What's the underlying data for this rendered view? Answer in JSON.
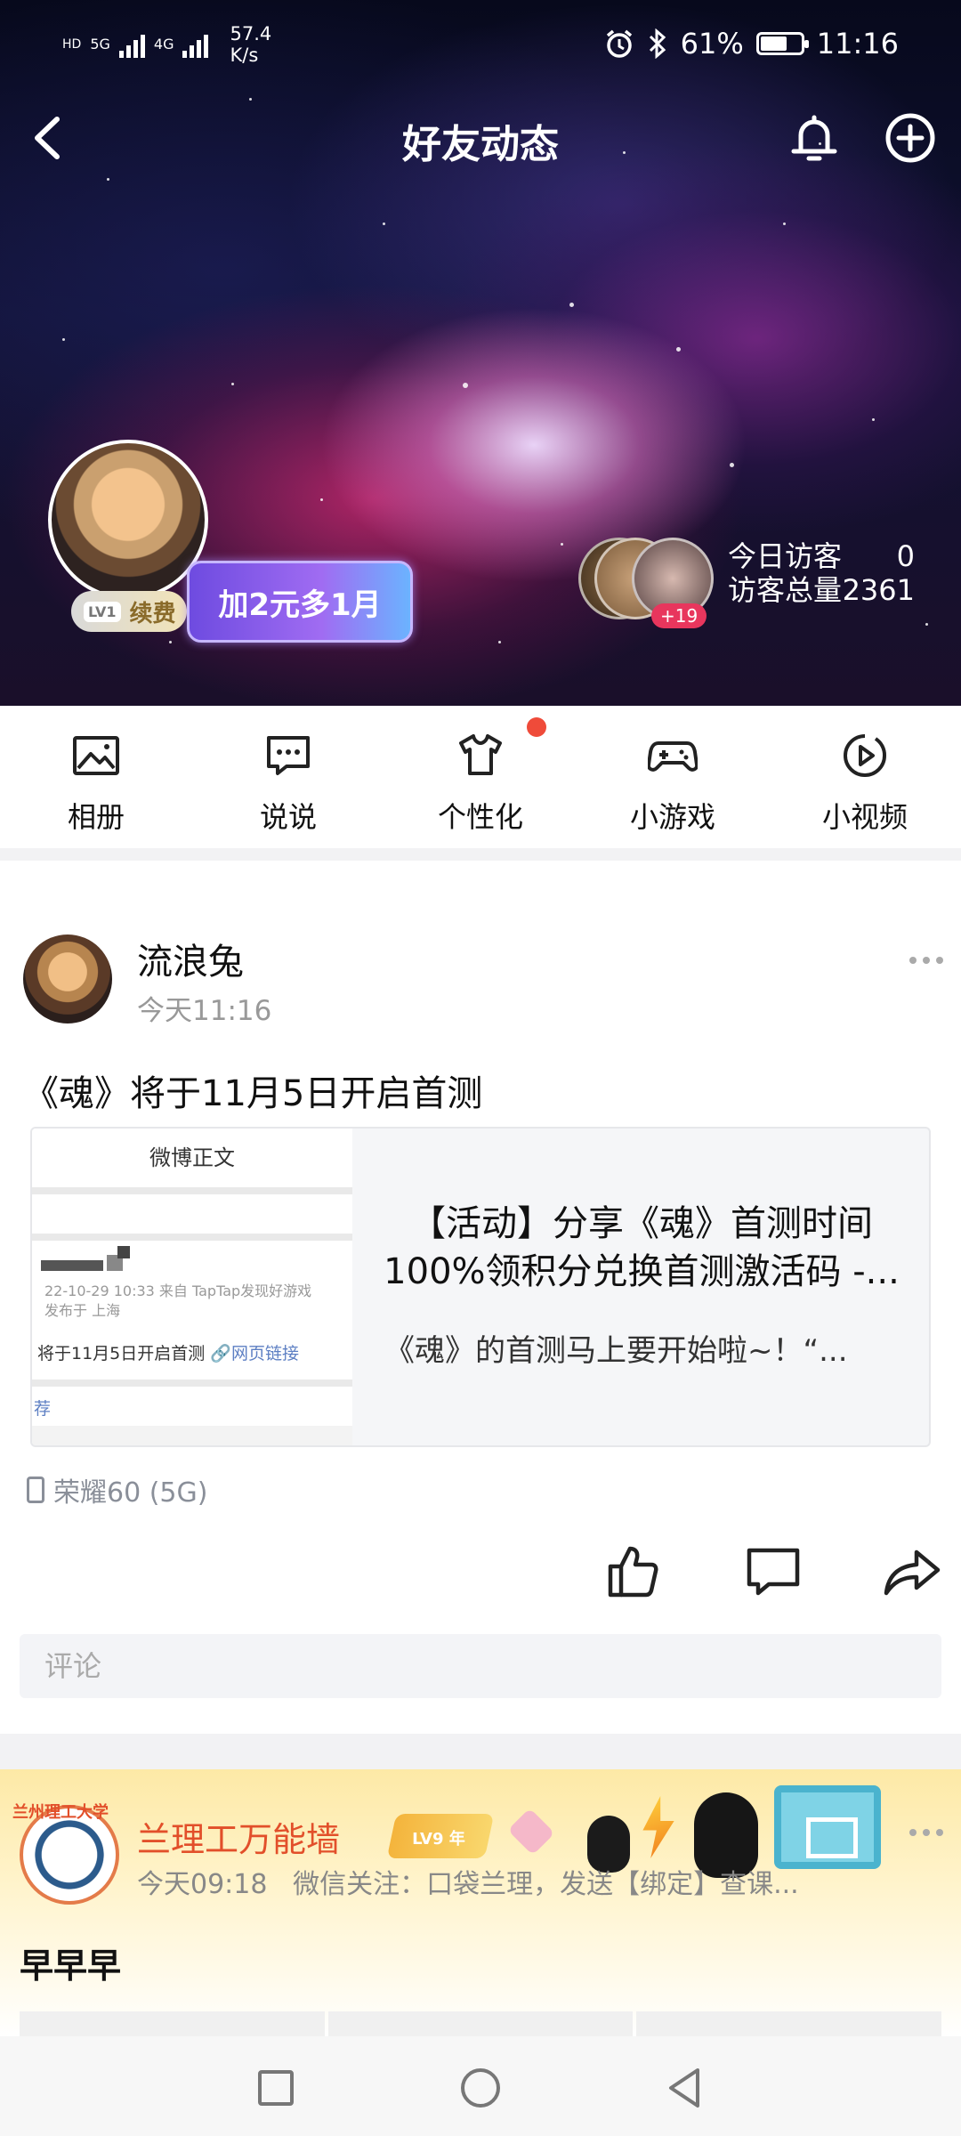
{
  "status_bar": {
    "net_label_1": "HD",
    "net_5g": "5G",
    "net_4g": "4G",
    "net_speed_value": "57.4",
    "net_speed_unit": "K/s",
    "battery": "61%",
    "battery_level": 0.61,
    "time": "11:16"
  },
  "header": {
    "title": "好友动态"
  },
  "profile": {
    "level_badge": "LV1",
    "renew_label": "续费",
    "promo_text": "加2元多1月",
    "visitors_more": "+19",
    "today_visitors_label": "今日访客",
    "today_visitors_value": "0",
    "total_visitors_label": "访客总量",
    "total_visitors_value": "2361"
  },
  "actions": [
    {
      "label": "相册",
      "icon": "photo-album-icon"
    },
    {
      "label": "说说",
      "icon": "message-icon"
    },
    {
      "label": "个性化",
      "icon": "tshirt-icon"
    },
    {
      "label": "小游戏",
      "icon": "gamepad-icon"
    },
    {
      "label": "小视频",
      "icon": "play-icon"
    }
  ],
  "post": {
    "username": "流浪兔",
    "time": "今天11:16",
    "text": "《魂》将于11月5日开启首测",
    "card": {
      "thumb_title": "微博正文",
      "thumb_meta_1": "22-10-29 10:33  来自 TapTap发现好游戏",
      "thumb_meta_2": "发布于 上海",
      "thumb_line": "将于11月5日开启首测",
      "thumb_link": "🔗网页链接",
      "thumb_rec": "荐",
      "title_line_1": "【活动】分享《魂》首测时间",
      "title_line_2": "100%领积分兑换首测激活码 -...",
      "desc": "《魂》的首测马上要开始啦~！“..."
    },
    "device": "荣耀60 (5G)",
    "comment_placeholder": "评论"
  },
  "post2": {
    "badge_text": "兰州理工大学",
    "username": "兰理工万能墙",
    "level_badge": "LV9",
    "year_badge": "年",
    "time": "今天09:18",
    "meta": "微信关注：口袋兰理，发送【绑定】查课...",
    "text": "早早早"
  },
  "colors": {
    "accent_red": "#ef4b3a",
    "visitor_badge": "#e8365d",
    "post2_name": "#e24f2a",
    "link_blue": "#5d7fc3"
  }
}
